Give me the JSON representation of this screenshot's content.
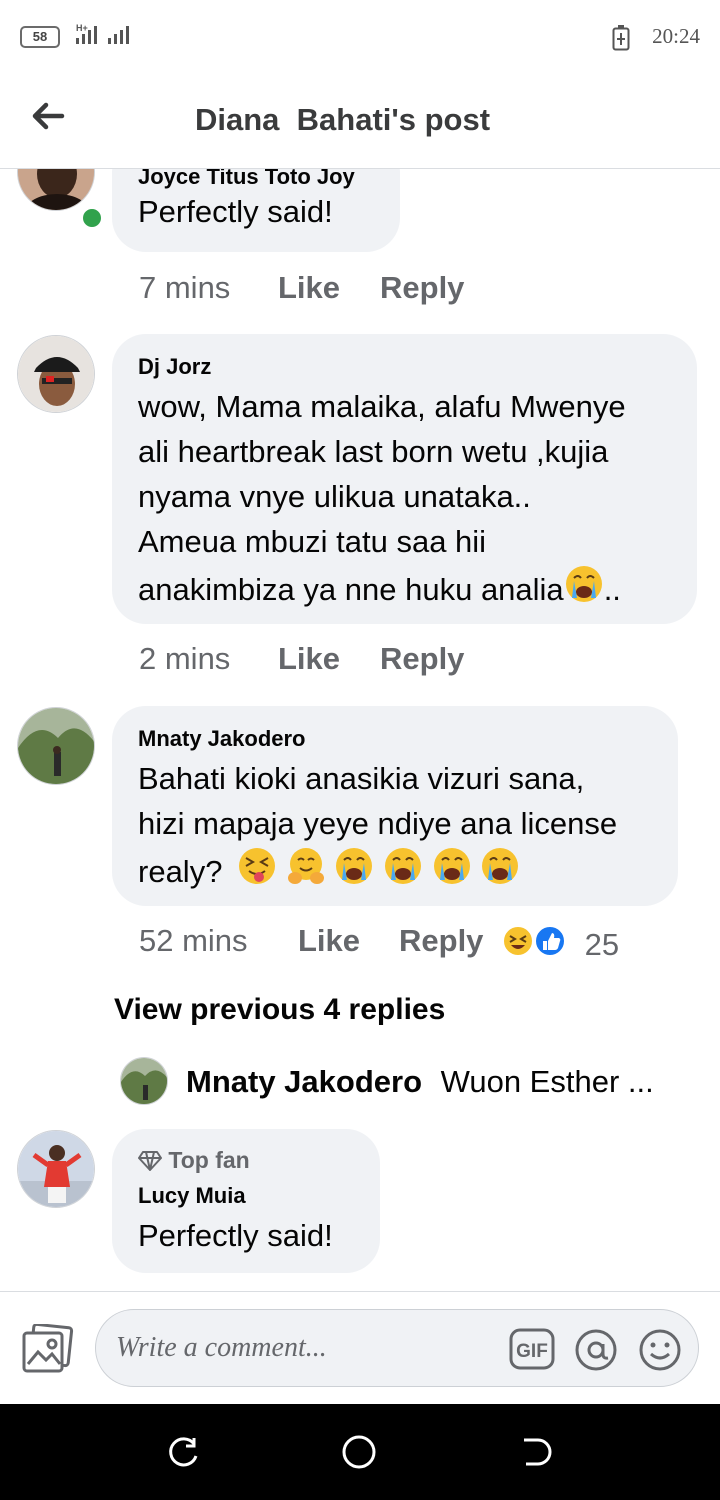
{
  "status_bar": {
    "badge": "58",
    "network": "H+",
    "time": "20:24"
  },
  "header": {
    "title": "Diana  Bahati's post"
  },
  "comments": [
    {
      "name": "Joyce Titus Toto Joy",
      "lines": [
        "Perfectly said!"
      ],
      "time": "7 mins",
      "like": "Like",
      "reply": "Reply"
    },
    {
      "name": "Dj Jorz",
      "lines": [
        "wow, Mama malaika, alafu Mwenye",
        "ali heartbreak last born wetu ,kujia",
        "nyama vnye ulikua unataka..",
        "Ameua mbuzi tatu saa hii",
        "anakimbiza ya nne huku analia"
      ],
      "line_suffix": "..",
      "time": "2 mins",
      "like": "Like",
      "reply": "Reply"
    },
    {
      "name": "Mnaty Jakodero",
      "lines": [
        "Bahati kioki anasikia vizuri sana,",
        "hizi mapaja yeye ndiye ana license",
        "realy?"
      ],
      "time": "52 mins",
      "like": "Like",
      "reply": "Reply",
      "reaction_count": "25"
    },
    {
      "badge": "Top fan",
      "name": "Lucy Muia",
      "lines": [
        "Perfectly said!"
      ]
    }
  ],
  "view_previous": "View previous 4 replies",
  "reply_preview": {
    "name": "Mnaty Jakodero",
    "text": "Wuon Esther ..."
  },
  "composer": {
    "placeholder": "Write a comment...",
    "gif_label": "GIF"
  },
  "colors": {
    "bubble": "#f0f2f5",
    "meta": "#65676b",
    "online": "#31a24c",
    "like_blue": "#1877f2"
  }
}
